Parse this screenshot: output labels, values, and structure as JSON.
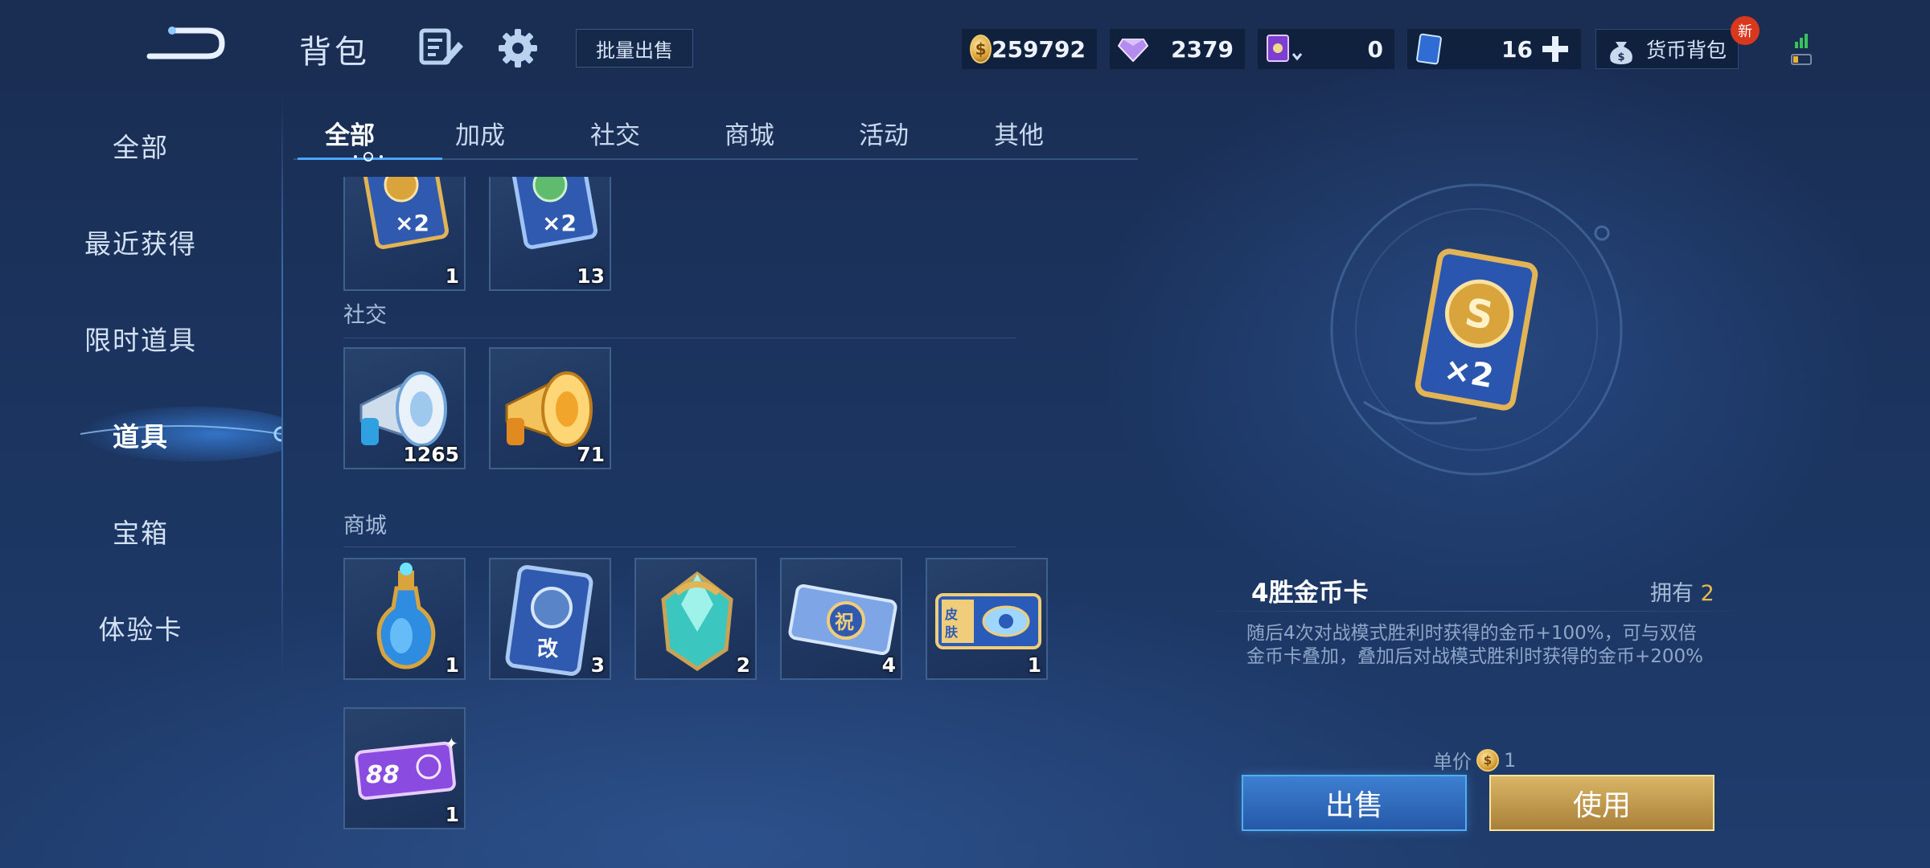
{
  "header": {
    "title": "背包",
    "batch_sell_label": "批量出售",
    "currencies": {
      "coin": "259792",
      "gem": "2379",
      "ticket": "0",
      "card": "16"
    },
    "currency_pack_label": "货币背包",
    "new_badge": "新",
    "colors": {
      "accent": "#e8b94d",
      "sell": "#2f6fc1",
      "use": "#c9a255"
    }
  },
  "sidebar": {
    "items": [
      {
        "label": "全部"
      },
      {
        "label": "最近获得"
      },
      {
        "label": "限时道具"
      },
      {
        "label": "道具",
        "active": true
      },
      {
        "label": "宝箱"
      },
      {
        "label": "体验卡"
      }
    ]
  },
  "tabs": [
    {
      "label": "全部",
      "active": true
    },
    {
      "label": "加成"
    },
    {
      "label": "社交"
    },
    {
      "label": "商城"
    },
    {
      "label": "活动"
    },
    {
      "label": "其他"
    }
  ],
  "sections": {
    "boost": {
      "items": [
        {
          "icon": "gold-card-x2-icon",
          "count": "1"
        },
        {
          "icon": "exp-card-x2-icon",
          "count": "13"
        }
      ]
    },
    "social": {
      "title": "社交",
      "items": [
        {
          "icon": "silver-megaphone-icon",
          "count": "1265"
        },
        {
          "icon": "gold-megaphone-icon",
          "count": "71"
        }
      ]
    },
    "shop": {
      "title": "商城",
      "items": [
        {
          "icon": "blue-potion-icon",
          "count": "1"
        },
        {
          "icon": "rename-card-icon",
          "count": "3"
        },
        {
          "icon": "crystal-gem-icon",
          "count": "2"
        },
        {
          "icon": "blessing-ticket-icon",
          "count": "4"
        },
        {
          "icon": "skin-ticket-icon",
          "count": "1"
        },
        {
          "icon": "purple-88-ticket-icon",
          "count": "1"
        }
      ]
    }
  },
  "detail": {
    "name": "4胜金币卡",
    "owned_label": "拥有",
    "owned_count": "2",
    "description": "随后4次对战模式胜利时获得的金币+100%，可与双倍金币卡叠加，叠加后对战模式胜利时获得的金币+200%",
    "price_label": "单价",
    "price_value": "1",
    "sell_label": "出售",
    "use_label": "使用"
  }
}
